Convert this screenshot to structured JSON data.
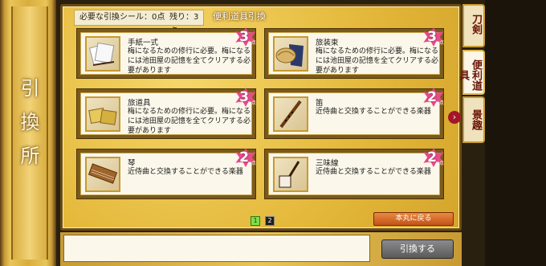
{
  "side_banner": {
    "title": "引換所"
  },
  "info": {
    "required_label": "必要な引換シール：0点",
    "remaining_label": "残り：3点"
  },
  "header": {
    "title": "便利道具引換"
  },
  "items": [
    {
      "name": "手紙一式",
      "desc": "梅になるための修行に必要。梅になるには池田屋の記憶を全てクリアする必要があります",
      "cost": "3",
      "unit": "点",
      "icon": "letter-set-icon"
    },
    {
      "name": "旅装束",
      "desc": "梅になるための修行に必要。梅になるには池田屋の記憶を全てクリアする必要があります",
      "cost": "3",
      "unit": "点",
      "icon": "travel-attire-icon"
    },
    {
      "name": "旅道具",
      "desc": "梅になるための修行に必要。梅になるには池田屋の記憶を全てクリアする必要があります",
      "cost": "3",
      "unit": "点",
      "icon": "travel-tools-icon"
    },
    {
      "name": "笛",
      "desc": "近侍曲と交換することができる楽器",
      "cost": "2",
      "unit": "点",
      "icon": "flute-icon"
    },
    {
      "name": "琴",
      "desc": "近侍曲と交換することができる楽器",
      "cost": "2",
      "unit": "点",
      "icon": "koto-icon"
    },
    {
      "name": "三味線",
      "desc": "近侍曲と交換することができる楽器",
      "cost": "2",
      "unit": "点",
      "icon": "shamisen-icon"
    }
  ],
  "pagination": {
    "page1": "1",
    "page2": "2"
  },
  "buttons": {
    "back": "本丸に戻る",
    "exchange": "引換する"
  },
  "tabs": [
    "刀剣",
    "便利道具",
    "景趣"
  ],
  "colors": {
    "gold": "#e4b83a",
    "badge": "#e64c8a",
    "tab_text": "#6a1408"
  }
}
